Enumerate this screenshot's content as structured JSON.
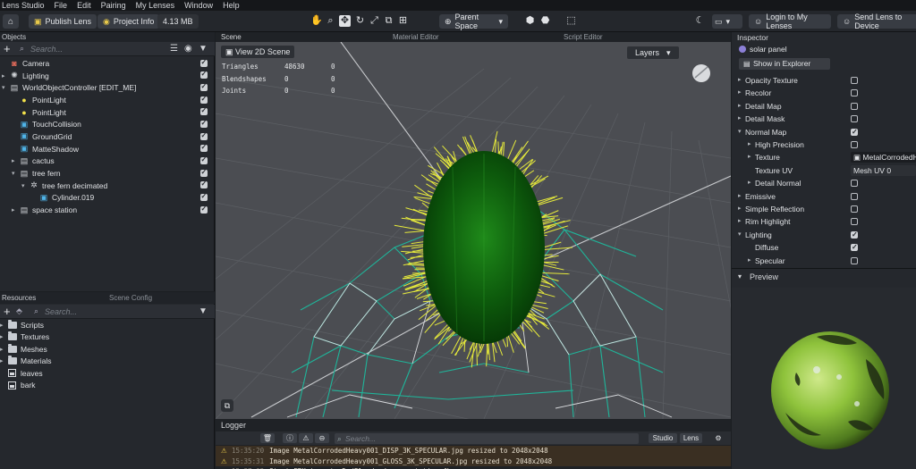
{
  "menubar": [
    "Lens Studio",
    "File",
    "Edit",
    "Pairing",
    "My Lenses",
    "Window",
    "Help"
  ],
  "toolbar": {
    "publish_label": "Publish Lens",
    "project_info_label": "Project Info",
    "size_label": "4.13 MB",
    "parent_space_label": "Parent Space",
    "login_label": "Login to My Lenses",
    "send_label": "Send Lens to Device"
  },
  "objects": {
    "title": "Objects",
    "search_placeholder": "Search...",
    "items": [
      {
        "label": "Camera",
        "icon": "camera-icon",
        "depth": 0,
        "arrow": ""
      },
      {
        "label": "Lighting",
        "icon": "light-icon",
        "depth": 0,
        "arrow": "▸"
      },
      {
        "label": "WorldObjectController [EDIT_ME]",
        "icon": "script-icon",
        "depth": 0,
        "arrow": "▾"
      },
      {
        "label": "PointLight",
        "icon": "bulb-icon",
        "depth": 1,
        "arrow": ""
      },
      {
        "label": "PointLight",
        "icon": "bulb-icon",
        "depth": 1,
        "arrow": ""
      },
      {
        "label": "TouchCollision",
        "icon": "mesh-icon",
        "depth": 1,
        "arrow": ""
      },
      {
        "label": "GroundGrid",
        "icon": "mesh-icon",
        "depth": 1,
        "arrow": ""
      },
      {
        "label": "MatteShadow",
        "icon": "mesh-icon",
        "depth": 1,
        "arrow": ""
      },
      {
        "label": "cactus",
        "icon": "object-icon",
        "depth": 1,
        "arrow": "▸"
      },
      {
        "label": "tree fern",
        "icon": "object-icon",
        "depth": 1,
        "arrow": "▾"
      },
      {
        "label": "tree fern decimated",
        "icon": "group-icon",
        "depth": 2,
        "arrow": "▾"
      },
      {
        "label": "Cylinder.019",
        "icon": "mesh-icon",
        "depth": 3,
        "arrow": ""
      },
      {
        "label": "space station",
        "icon": "object-icon",
        "depth": 1,
        "arrow": "▸"
      }
    ]
  },
  "resources": {
    "tab_resources": "Resources",
    "tab_scene_config": "Scene Config",
    "search_placeholder": "Search...",
    "items": [
      {
        "label": "Scripts",
        "type": "folder"
      },
      {
        "label": "Textures",
        "type": "folder"
      },
      {
        "label": "Meshes",
        "type": "folder"
      },
      {
        "label": "Materials",
        "type": "folder"
      },
      {
        "label": "leaves",
        "type": "image"
      },
      {
        "label": "bark",
        "type": "image"
      }
    ]
  },
  "scene": {
    "tabs": [
      "Scene",
      "Material Editor",
      "Script Editor"
    ],
    "view2d_label": "View 2D Scene",
    "layers_label": "Layers",
    "stats": [
      {
        "name": "Triangles",
        "a": "48630",
        "b": "0"
      },
      {
        "name": "Blendshapes",
        "a": "0",
        "b": "0"
      },
      {
        "name": "Joints",
        "a": "0",
        "b": "0"
      }
    ]
  },
  "logger": {
    "title": "Logger",
    "search_placeholder": "Search...",
    "studio_label": "Studio",
    "lens_label": "Lens",
    "rows": [
      {
        "time": "15:35:20",
        "text": "Image MetalCorrodedHeavy001_DISP_3K_SPECULAR.jpg resized to 2048x2048"
      },
      {
        "time": "15:35:31",
        "text": "Image MetalCorrodedHeavy001_GLOSS_3K_SPECULAR.jpg resized to 2048x2048"
      },
      {
        "time": "15:37:03",
        "text": "Start FBX import: D:/Blender/space station.fbx"
      }
    ]
  },
  "inspector": {
    "title": "Inspector",
    "object_name": "solar panel",
    "show_explorer_label": "Show in Explorer",
    "rows": [
      {
        "label": "Opacity Texture",
        "arrow": "▸",
        "indent": 0,
        "checked": false
      },
      {
        "label": "Recolor",
        "arrow": "▸",
        "indent": 0,
        "checked": false
      },
      {
        "label": "Detail Map",
        "arrow": "▸",
        "indent": 0,
        "checked": false
      },
      {
        "label": "Detail Mask",
        "arrow": "▸",
        "indent": 0,
        "checked": false
      },
      {
        "label": "Normal Map",
        "arrow": "▾",
        "indent": 0,
        "checked": true
      },
      {
        "label": "High Precision",
        "arrow": "▸",
        "indent": 1,
        "checked": false
      },
      {
        "label": "Texture",
        "arrow": "▸",
        "indent": 1,
        "field": "MetalCorrodedHeavy"
      },
      {
        "label": "Texture UV",
        "arrow": "",
        "indent": 1,
        "field": "Mesh UV 0"
      },
      {
        "label": "Detail Normal",
        "arrow": "▸",
        "indent": 1,
        "checked": false
      },
      {
        "label": "Emissive",
        "arrow": "▸",
        "indent": 0,
        "checked": false
      },
      {
        "label": "Simple Reflection",
        "arrow": "▸",
        "indent": 0,
        "checked": false
      },
      {
        "label": "Rim Highlight",
        "arrow": "▸",
        "indent": 0,
        "checked": false
      },
      {
        "label": "Lighting",
        "arrow": "▾",
        "indent": 0,
        "checked": true
      },
      {
        "label": "Diffuse",
        "arrow": "",
        "indent": 1,
        "checked": true
      },
      {
        "label": "Specular",
        "arrow": "▸",
        "indent": 1,
        "checked": false
      }
    ]
  },
  "preview": {
    "title": "Preview"
  }
}
